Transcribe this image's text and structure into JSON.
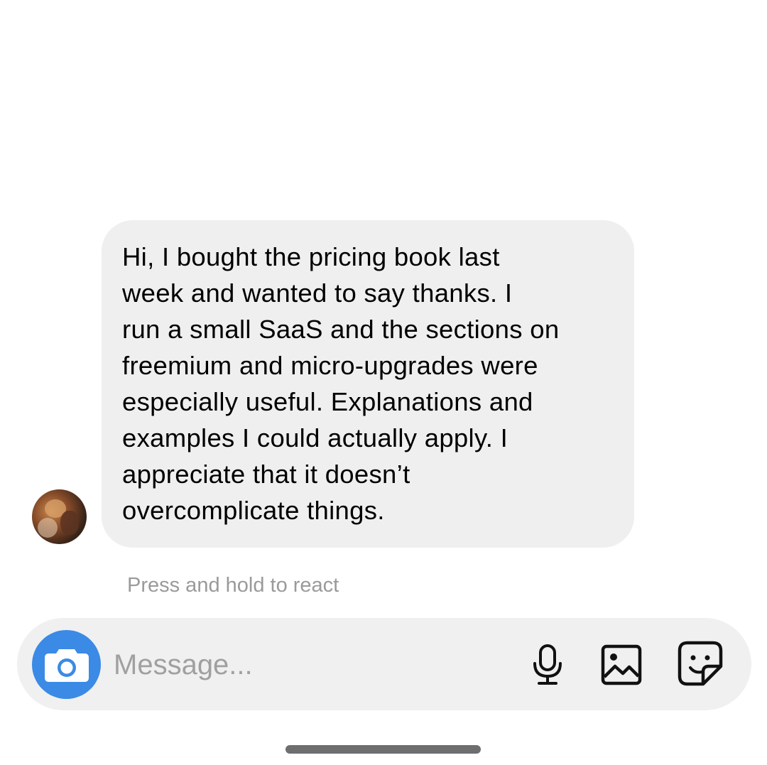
{
  "message": {
    "text": "Hi, I bought the pricing book last\nweek and wanted to say thanks. I\nrun a small SaaS and the sections on\nfreemium and micro-upgrades were\nespecially useful. Explanations and\nexamples I could actually apply. I\nappreciate that it doesn’t\novercomplicate things."
  },
  "hint_text": "Press and hold to react",
  "composer": {
    "placeholder": "Message...",
    "camera_icon": "camera-icon",
    "mic_icon": "microphone-icon",
    "gallery_icon": "image-icon",
    "sticker_icon": "sticker-icon"
  },
  "colors": {
    "accent": "#3b8ae6",
    "bubble": "#efefef",
    "composer": "#f0f0f0",
    "hint": "#9a9a9a"
  }
}
